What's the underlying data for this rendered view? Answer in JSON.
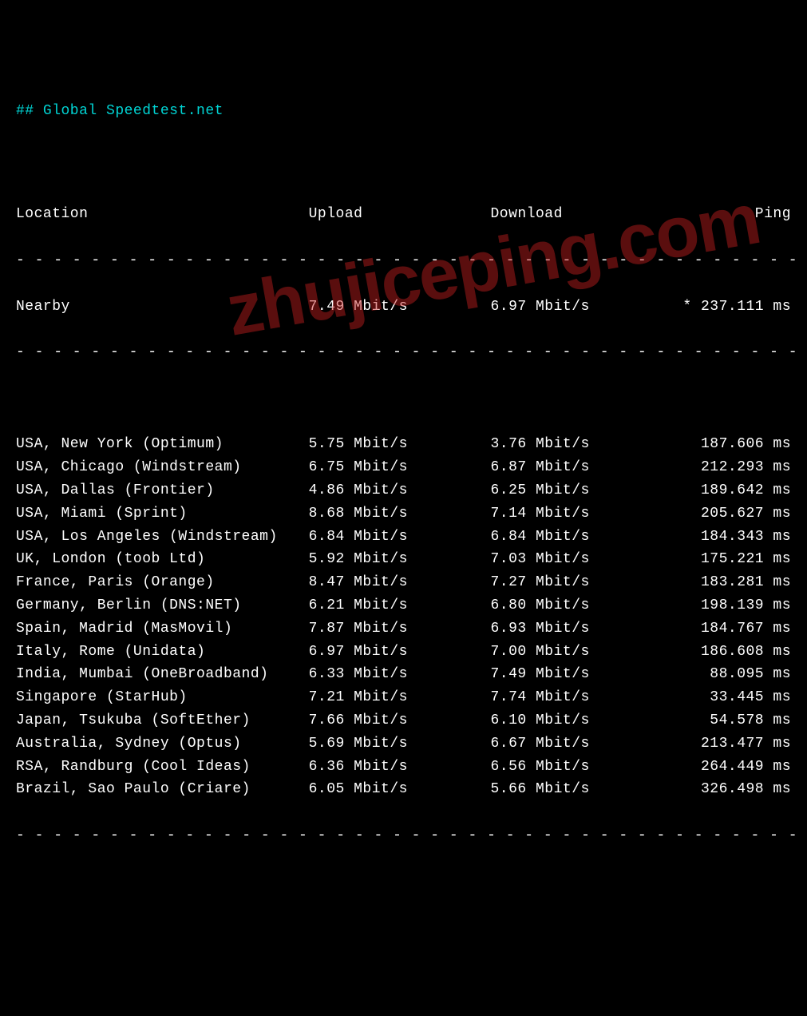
{
  "title": "## Global Speedtest.net",
  "headers": {
    "location": "Location",
    "upload": "Upload",
    "download": "Download",
    "ping": "Ping"
  },
  "nearby": {
    "location": "Nearby",
    "upload": "7.49 Mbit/s",
    "download": "6.97 Mbit/s",
    "ping": "* 237.111 ms"
  },
  "rows": [
    {
      "location": "USA, New York (Optimum)",
      "upload": "5.75 Mbit/s",
      "download": "3.76 Mbit/s",
      "ping": "187.606 ms"
    },
    {
      "location": "USA, Chicago (Windstream)",
      "upload": "6.75 Mbit/s",
      "download": "6.87 Mbit/s",
      "ping": "212.293 ms"
    },
    {
      "location": "USA, Dallas (Frontier)",
      "upload": "4.86 Mbit/s",
      "download": "6.25 Mbit/s",
      "ping": "189.642 ms"
    },
    {
      "location": "USA, Miami (Sprint)",
      "upload": "8.68 Mbit/s",
      "download": "7.14 Mbit/s",
      "ping": "205.627 ms"
    },
    {
      "location": "USA, Los Angeles (Windstream)",
      "upload": "6.84 Mbit/s",
      "download": "6.84 Mbit/s",
      "ping": "184.343 ms"
    },
    {
      "location": "UK, London (toob Ltd)",
      "upload": "5.92 Mbit/s",
      "download": "7.03 Mbit/s",
      "ping": "175.221 ms"
    },
    {
      "location": "France, Paris (Orange)",
      "upload": "8.47 Mbit/s",
      "download": "7.27 Mbit/s",
      "ping": "183.281 ms"
    },
    {
      "location": "Germany, Berlin (DNS:NET)",
      "upload": "6.21 Mbit/s",
      "download": "6.80 Mbit/s",
      "ping": "198.139 ms"
    },
    {
      "location": "Spain, Madrid (MasMovil)",
      "upload": "7.87 Mbit/s",
      "download": "6.93 Mbit/s",
      "ping": "184.767 ms"
    },
    {
      "location": "Italy, Rome (Unidata)",
      "upload": "6.97 Mbit/s",
      "download": "7.00 Mbit/s",
      "ping": "186.608 ms"
    },
    {
      "location": "India, Mumbai (OneBroadband)",
      "upload": "6.33 Mbit/s",
      "download": "7.49 Mbit/s",
      "ping": "88.095 ms"
    },
    {
      "location": "Singapore (StarHub)",
      "upload": "7.21 Mbit/s",
      "download": "7.74 Mbit/s",
      "ping": "33.445 ms"
    },
    {
      "location": "Japan, Tsukuba (SoftEther)",
      "upload": "7.66 Mbit/s",
      "download": "6.10 Mbit/s",
      "ping": "54.578 ms"
    },
    {
      "location": "Australia, Sydney (Optus)",
      "upload": "5.69 Mbit/s",
      "download": "6.67 Mbit/s",
      "ping": "213.477 ms"
    },
    {
      "location": "RSA, Randburg (Cool Ideas)",
      "upload": "6.36 Mbit/s",
      "download": "6.56 Mbit/s",
      "ping": "264.449 ms"
    },
    {
      "location": "Brazil, Sao Paulo (Criare)",
      "upload": "6.05 Mbit/s",
      "download": "5.66 Mbit/s",
      "ping": "326.498 ms"
    }
  ],
  "watermark": "zhujiceping.com",
  "divider": "- - - - - - - - - - - - - - - - - - - - - - - - - - - - - - - - - - - - - - - - - - - - - - - - -"
}
